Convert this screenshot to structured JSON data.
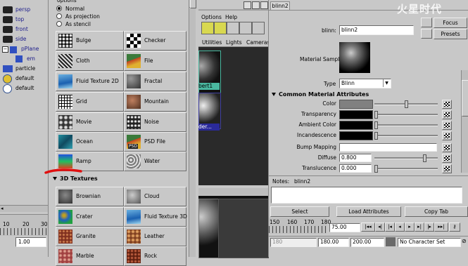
{
  "outliner": {
    "items": [
      "persp",
      "top",
      "front",
      "side",
      "pPlane",
      "em",
      "particle",
      "default",
      "default"
    ]
  },
  "timeline": {
    "ticks": [
      "10",
      "20",
      "30"
    ],
    "value": "1.00"
  },
  "create_panel": {
    "options": {
      "label": "options",
      "normal": "Normal",
      "projection": "As projection",
      "stencil": "As stencil"
    },
    "textures_2d": [
      {
        "label": "Bulge"
      },
      {
        "label": "Checker"
      },
      {
        "label": "Cloth"
      },
      {
        "label": "File"
      },
      {
        "label": "Fluid Texture 2D"
      },
      {
        "label": "Fractal"
      },
      {
        "label": "Grid"
      },
      {
        "label": "Mountain"
      },
      {
        "label": "Movie"
      },
      {
        "label": "Noise"
      },
      {
        "label": "Ocean"
      },
      {
        "label": "PSD File"
      },
      {
        "label": "Ramp"
      },
      {
        "label": "Water"
      }
    ],
    "section_3d": "3D Textures",
    "textures_3d": [
      {
        "label": "Brownian"
      },
      {
        "label": "Cloud"
      },
      {
        "label": "Crater"
      },
      {
        "label": "Fluid Texture 3D"
      },
      {
        "label": "Granite"
      },
      {
        "label": "Leather"
      },
      {
        "label": "Marble"
      },
      {
        "label": "Rock"
      }
    ],
    "psd_badge": "PSD"
  },
  "hypershade": {
    "menu": [
      "Options",
      "Help"
    ],
    "tabs": [
      "Utilities",
      "Lights",
      "Cameras"
    ],
    "swatch1_label": "bert1",
    "swatch2_label": "der..."
  },
  "attribute_editor": {
    "tab": "blinn2",
    "watermark": "火星时代",
    "node_label": "blinn:",
    "node_value": "blinn2",
    "focus": "Focus",
    "presets": "Presets",
    "material_sample": "Material Sample",
    "type_label": "Type",
    "type_value": "Blinn",
    "section": "Common Material Attributes",
    "attrs": [
      {
        "label": "Color",
        "level": 0.5
      },
      {
        "label": "Transparency",
        "level": 0.0
      },
      {
        "label": "Ambient Color",
        "level": 0.0
      },
      {
        "label": "Incandescence",
        "level": 0.0
      },
      {
        "label": "Bump Mapping"
      },
      {
        "label": "Diffuse",
        "value": "0.800",
        "level": 0.8
      },
      {
        "label": "Translucence",
        "value": "0.000",
        "level": 0.0
      }
    ],
    "notes_label": "Notes:",
    "notes_value": "blinn2",
    "buttons": [
      "Select",
      "Load Attributes",
      "Copy Tab"
    ]
  },
  "playback": {
    "ticks": [
      "150",
      "160",
      "170",
      "180"
    ],
    "current_frame": "75.00",
    "range_start": "180.00",
    "range_end": "200.00",
    "character_set": "No Character Set",
    "start_field": "180"
  },
  "colors": {
    "highlight_teal": "#4ab8a0",
    "selection_blue": "#2a2a9a",
    "annotation_red": "#e01010"
  }
}
